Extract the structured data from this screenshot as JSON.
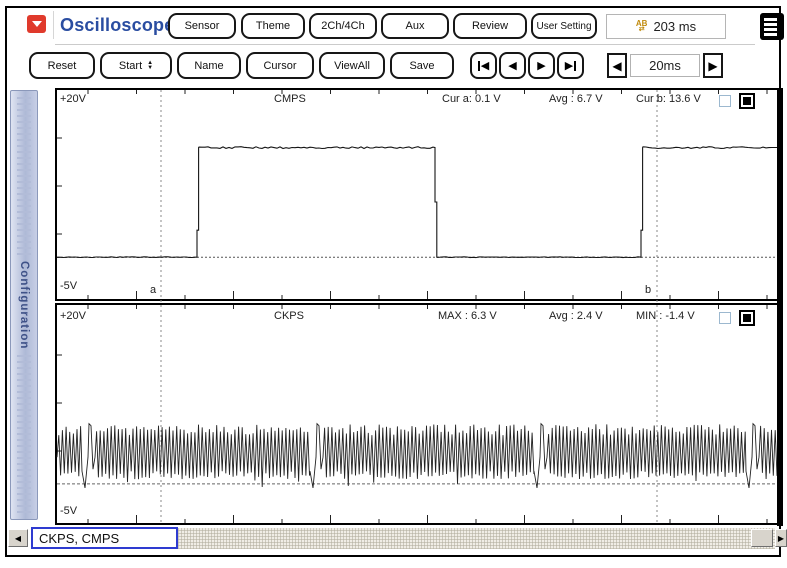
{
  "app": {
    "title": "Oscilloscope",
    "time_display": "203 ms"
  },
  "toolbar1": {
    "buttons": [
      "Sensor",
      "Theme",
      "2Ch/4Ch",
      "Aux",
      "Review",
      "User Setting"
    ]
  },
  "toolbar2": {
    "buttons": [
      "Reset",
      "Start",
      "Name",
      "Cursor",
      "ViewAll",
      "Save"
    ],
    "timebase": "20ms"
  },
  "sidebar": {
    "label": "Configuration"
  },
  "statusbar": {
    "selection": "CKPS, CMPS"
  },
  "cursors": {
    "a_label": "a",
    "b_label": "b"
  },
  "channels": [
    {
      "name": "CMPS",
      "scale_top": "+20V",
      "scale_bottom": "-5V",
      "stat1": "Cur a: 0.1 V",
      "stat2": "Avg : 6.7 V",
      "stat3": "Cur b: 13.6 V"
    },
    {
      "name": "CKPS",
      "scale_top": "+20V",
      "scale_bottom": "-5V",
      "stat1": "MAX : 6.3 V",
      "stat2": "Avg : 2.4 V",
      "stat3": "MIN : -1.4 V"
    }
  ],
  "chart_data": {
    "type": "line",
    "x_unit": "ms",
    "x_range": [
      0,
      180
    ],
    "timebase_per_div": "20ms",
    "record_length_ms": 203,
    "cursors_ms": {
      "a": 26,
      "b": 150
    },
    "series": [
      {
        "name": "CMPS",
        "wave": "square",
        "y_range_v": [
          -5,
          20
        ],
        "low_v": 0.1,
        "high_v": 13.8,
        "baseline_v": 0.1,
        "edges": [
          {
            "t_ms": 35,
            "edge": "rise"
          },
          {
            "t_ms": 94.5,
            "edge": "fall"
          },
          {
            "t_ms": 146,
            "edge": "rise"
          }
        ],
        "stats": {
          "cur_a_v": 0.1,
          "avg_v": 6.7,
          "cur_b_v": 13.6
        }
      },
      {
        "name": "CKPS",
        "wave": "ac_tooth",
        "y_range_v": [
          -5,
          20
        ],
        "tooth_period_ms": 0.9,
        "missing_tooth_ms": [
          8,
          65,
          121,
          174
        ],
        "typ_max_v": 6.3,
        "typ_min_v": -0.4,
        "spike_min_v": -1.4,
        "baseline_v": -0.9,
        "stats": {
          "max_v": 6.3,
          "avg_v": 2.4,
          "min_v": -1.4
        }
      }
    ]
  }
}
